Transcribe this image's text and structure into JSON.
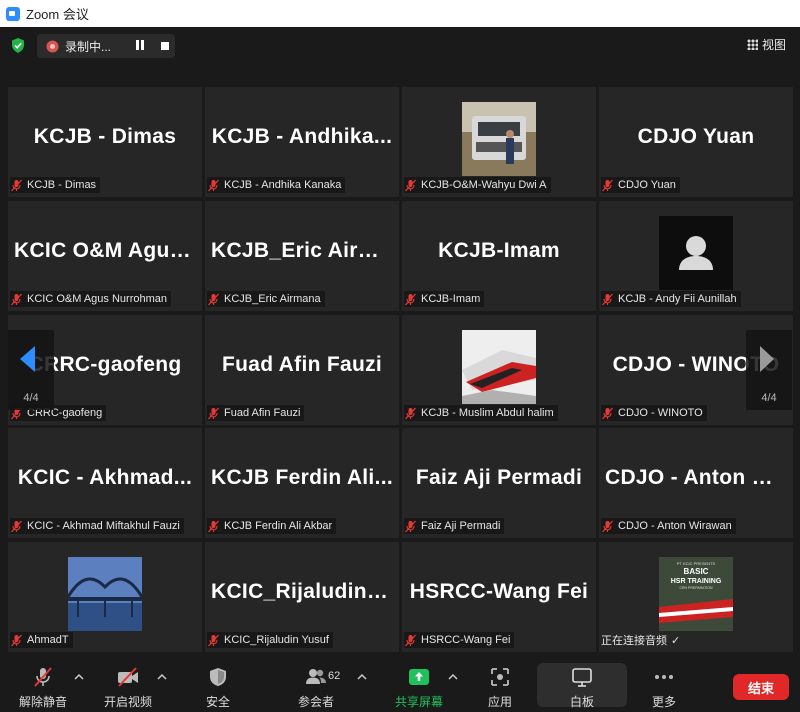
{
  "window": {
    "title": "Zoom 会议"
  },
  "topbar": {
    "recording_label": "录制中...",
    "view_label": "视图"
  },
  "tiles": [
    {
      "name": "KCJB - Dimas",
      "label": "KCJB - Dimas",
      "type": "text"
    },
    {
      "name": "KCJB - Andhika...",
      "label": "KCJB - Andhika Kanaka",
      "type": "text"
    },
    {
      "name": "",
      "label": "KCJB-O&M-Wahyu Dwi A",
      "type": "photo-truck"
    },
    {
      "name": "CDJO Yuan",
      "label": "CDJO Yuan",
      "type": "text"
    },
    {
      "name": "KCIC O&M Agus...",
      "label": "KCIC O&M Agus Nurrohman",
      "type": "text"
    },
    {
      "name": "KCJB_Eric  Airma...",
      "label": "KCJB_Eric Airmana",
      "type": "text"
    },
    {
      "name": "KCJB-Imam",
      "label": "KCJB-Imam",
      "type": "text"
    },
    {
      "name": "",
      "label": "KCJB - Andy Fii Aunillah",
      "type": "photo-avatar"
    },
    {
      "name": "CRRC-gaofeng",
      "label": "CRRC-gaofeng",
      "type": "text"
    },
    {
      "name": "Fuad Afin Fauzi",
      "label": "Fuad Afin Fauzi",
      "type": "text"
    },
    {
      "name": "",
      "label": "KCJB - Muslim Abdul halim",
      "type": "photo-train"
    },
    {
      "name": "CDJO - WINOTO",
      "label": "CDJO - WINOTO",
      "type": "text"
    },
    {
      "name": "KCIC - Akhmad...",
      "label": "KCIC - Akhmad Miftakhul Fauzi",
      "type": "text"
    },
    {
      "name": "KCJB Ferdin Ali...",
      "label": "KCJB Ferdin Ali Akbar",
      "type": "text"
    },
    {
      "name": "Faiz Aji Permadi",
      "label": "Faiz Aji Permadi",
      "type": "text"
    },
    {
      "name": "CDJO - Anton W...",
      "label": "CDJO - Anton Wirawan",
      "type": "text"
    },
    {
      "name": "",
      "label": "AhmadT",
      "type": "photo-bridge"
    },
    {
      "name": "KCIC_Rijaludin Y...",
      "label": "KCIC_Rijaludin Yusuf",
      "type": "text"
    },
    {
      "name": "HSRCC-Wang Fei",
      "label": "HSRCC-Wang Fei",
      "type": "text"
    },
    {
      "name": "",
      "label": "正在连接音频",
      "type": "photo-hsr",
      "connecting": true
    }
  ],
  "hsr_poster": {
    "line1": "PT KCIC PRESENTS",
    "line2": "BASIC",
    "line3": "HSR TRAINING",
    "line4": "CRH PREPARATION"
  },
  "pagination": {
    "left": "4/4",
    "right": "4/4"
  },
  "toolbar": {
    "unmute": "解除静音",
    "start_video": "开启视频",
    "security": "安全",
    "participants": "参会者",
    "participant_count": "62",
    "share_screen": "共享屏幕",
    "apps": "应用",
    "whiteboard": "白板",
    "more": "更多",
    "end": "结束"
  },
  "colors": {
    "accent_blue": "#2d8cff",
    "share_green": "#20c05c",
    "end_red": "#e02828",
    "mute_red": "#e53935"
  }
}
